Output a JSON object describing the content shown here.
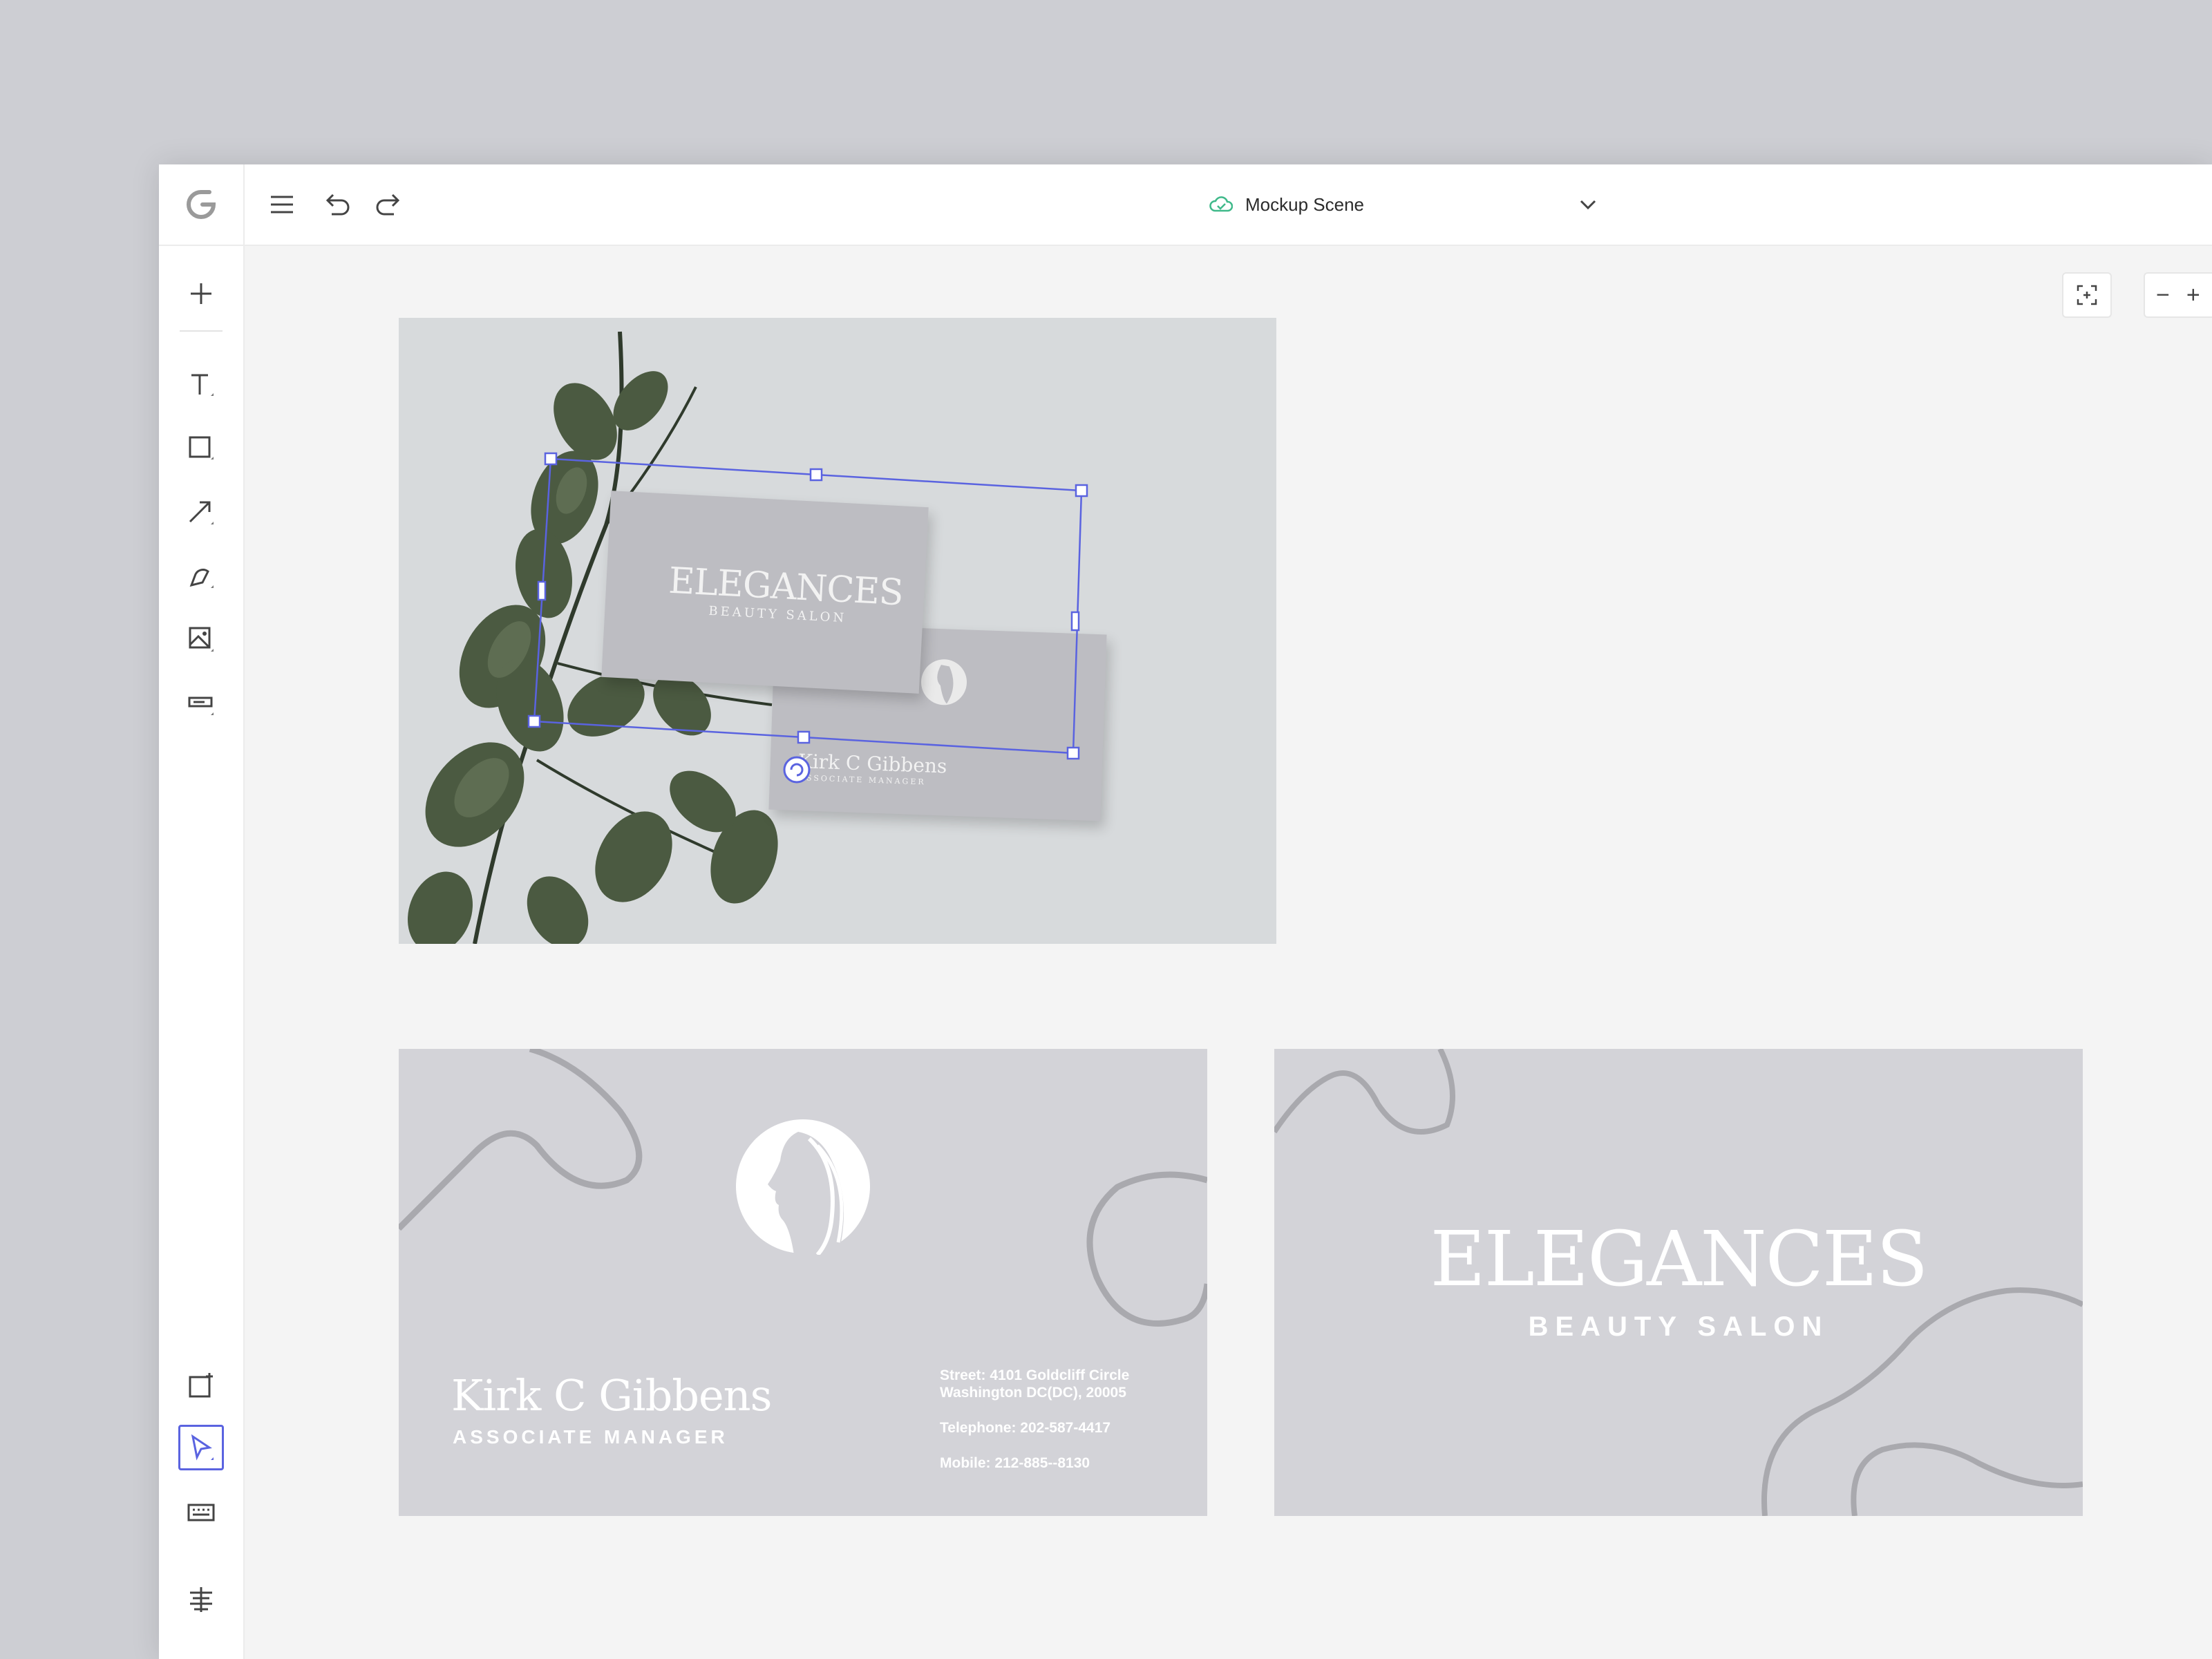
{
  "header": {
    "document_title": "Mockup Scene",
    "menu_icon": "hamburger-menu-icon",
    "undo_icon": "undo-icon",
    "redo_icon": "redo-icon",
    "logo_icon": "gravit-logo-icon",
    "cloud_icon": "cloud-saved-icon"
  },
  "sidebar": {
    "tools": [
      "add-icon",
      "text-tool-icon",
      "rectangle-tool-icon",
      "line-tool-icon",
      "pen-tool-icon",
      "image-tool-icon",
      "component-tool-icon"
    ],
    "bottom_tools": [
      "new-page-icon",
      "pointer-tool-icon",
      "keyboard-icon",
      "layout-settings-icon"
    ]
  },
  "canvas_controls": {
    "zoom_out": "−",
    "zoom_in": "+"
  },
  "mockup": {
    "brand": "ELEGANCES",
    "brand_sub": "BEAUTY SALON",
    "name": "Kirk C Gibbens",
    "role": "ASSOCIATE MANAGER"
  },
  "card_back": {
    "name": "Kirk C Gibbens",
    "role": "ASSOCIATE MANAGER",
    "street_line1": "Street: 4101 Goldcliff Circle",
    "street_line2": "Washington DC(DC), 20005",
    "telephone": "Telephone: 202-587-4417",
    "mobile": "Mobile: 212-885--8130"
  },
  "card_front": {
    "brand": "ELEGANCES",
    "brand_sub": "BEAUTY SALON"
  },
  "colors": {
    "selection": "#5a63e0",
    "card_bg": "#d3d3d8",
    "canvas_bg": "#f4f4f4"
  }
}
